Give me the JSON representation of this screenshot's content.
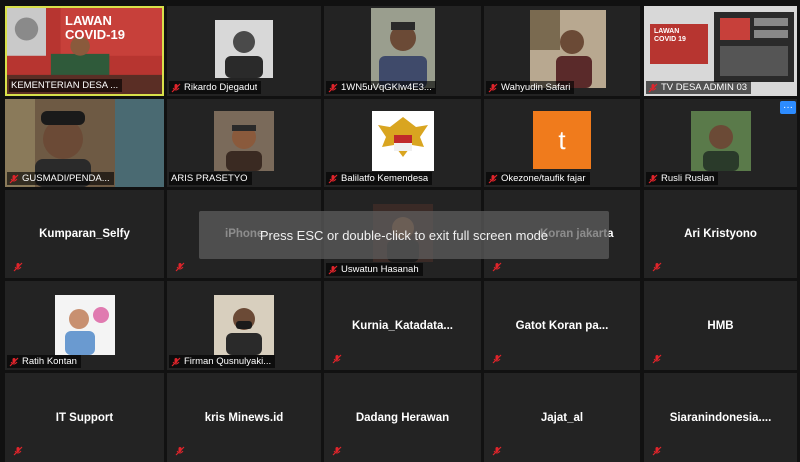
{
  "overlay_message": "Press ESC or double-click to exit full screen mode",
  "more_button_label": "···",
  "colors": {
    "active_border": "#d8e04a",
    "muted_mic": "#e0242b",
    "tile_bg": "#232323",
    "accent": "#2d8cff"
  },
  "participants": [
    {
      "name": "KEMENTERIAN DESA ...",
      "banner": "LAWAN COVID-19"
    },
    {
      "name": "Rikardo Djegadut"
    },
    {
      "name": "1WN5uVqGKlw4E3..."
    },
    {
      "name": "Wahyudin Safari"
    },
    {
      "name": "TV DESA ADMIN 03",
      "banner": "LAWAN COVID 19"
    },
    {
      "name": "GUSMADI/PENDA..."
    },
    {
      "name": "ARIS PRASETYO"
    },
    {
      "name": "Balilatfo Kemendesa"
    },
    {
      "name": "Okezone/taufik fajar",
      "avatar_letter": "t"
    },
    {
      "name": "Rusli Ruslan"
    },
    {
      "name": "Kumparan_Selfy"
    },
    {
      "name": "iPhone"
    },
    {
      "name": "Uswatun Hasanah"
    },
    {
      "name": "Koran jakarta"
    },
    {
      "name": "Ari Kristyono"
    },
    {
      "name": "Ratih Kontan"
    },
    {
      "name": "Firman Qusnulyaki..."
    },
    {
      "name": "Kurnia_Katadata..."
    },
    {
      "name": "Gatot Koran pa..."
    },
    {
      "name": "HMB"
    },
    {
      "name": "IT Support"
    },
    {
      "name": "kris Minews.id"
    },
    {
      "name": "Dadang Herawan"
    },
    {
      "name": "Jajat_al"
    },
    {
      "name": "Siaranindonesia...."
    }
  ]
}
